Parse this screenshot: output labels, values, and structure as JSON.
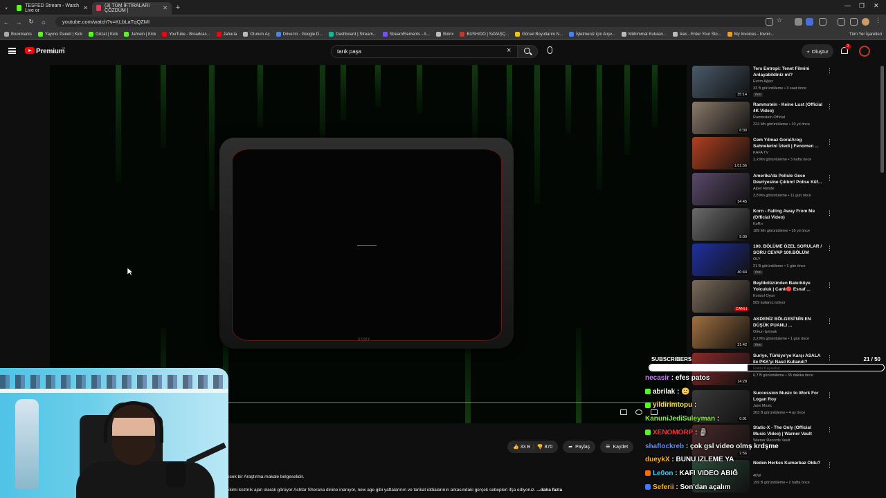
{
  "browser": {
    "tabs": [
      {
        "label": "TESFED Stream - Watch Live or",
        "color": "#53fc18",
        "active": false
      },
      {
        "label": "(3) TÜM İFTİRALARI ÇÖZDÜM |",
        "color": "#ff2d55",
        "active": true
      }
    ],
    "url": "youtube.com/watch?v=KLbLaTqQZMI",
    "bookmarks": [
      {
        "label": "Bookmarks",
        "color": "#aaaaaa"
      },
      {
        "label": "Yayıncı Paneli | Kick",
        "color": "#53fc18"
      },
      {
        "label": "Gözat | Kick",
        "color": "#53fc18"
      },
      {
        "label": "Jahrein | Kick",
        "color": "#53fc18"
      },
      {
        "label": "YouTube - Broadcas...",
        "color": "#ff0000"
      },
      {
        "label": "Jaharia",
        "color": "#ff0000"
      },
      {
        "label": "Oturum Aç",
        "color": "#bbbbbb"
      },
      {
        "label": "Drive'ım - Google D...",
        "color": "#4285f4"
      },
      {
        "label": "Dashboard | Stream...",
        "color": "#00bfa5"
      },
      {
        "label": "StreamElements - A...",
        "color": "#7b4dff"
      },
      {
        "label": "Botrix",
        "color": "#bbbbbb"
      },
      {
        "label": "BUSHIDO | SAVAŞÇ...",
        "color": "#c0392b"
      },
      {
        "label": "Görsel Boyutlarını N...",
        "color": "#f1c40f"
      },
      {
        "label": "İşletmeniz için Alışv...",
        "color": "#4285f4"
      },
      {
        "label": "Mühimmat Kutuları...",
        "color": "#bbbbbb"
      },
      {
        "label": "ikas - Enter Your Sto...",
        "color": "#bbbbbb"
      },
      {
        "label": "My Invoices - Invoic...",
        "color": "#f39c12"
      }
    ],
    "all_bookmarks": "Tüm Yer İşaretleri"
  },
  "youtube": {
    "brand": "Premium",
    "brand_region": "TR",
    "search_value": "tarık paşa",
    "create_label": "Oluştur",
    "notification_count": "3"
  },
  "video": {
    "tv_brand": "SONY",
    "actions": {
      "likes": "33 B",
      "dislikes": "870",
      "share": "Paylaş",
      "save": "Kaydet"
    },
    "description_line1": "ecek bir Araştırma makale belgeselidir.",
    "description_line2": "ut Ekimi kozmik ajan olarak görüyor Ashtar Sherana dinine inanıyor, new age gibi yaftalarının ve tarikat iddialarının arkasındaki gerçek sebepleri ifşa ediyoruz.",
    "description_more": "...daha fazla"
  },
  "recommendations": [
    {
      "title": "Ters Entropi: Tenet Filmini Anlayabildiniz mi?",
      "channel": "Evrim Ağacı",
      "meta": "33 B görüntüleme • 3 saat önce",
      "badge": "Yeni",
      "duration": "35:14",
      "thumb": "#4a5a6a"
    },
    {
      "title": "Rammstein - Keine Lust (Official 4K Video)",
      "channel": "Rammstein Official",
      "meta": "224 Mn görüntüleme • 10 yıl önce",
      "badge": "",
      "duration": "6:00",
      "thumb": "#8a7a6a"
    },
    {
      "title": "Cem Yılmaz Gora/Arog Sahnelerini İzledi | Fenomen ...",
      "channel": "KAFA TV",
      "meta": "2,2 Mn görüntüleme • 3 hafta önce",
      "badge": "",
      "duration": "1:01:56",
      "thumb": "#b04020"
    },
    {
      "title": "Amerika'da Polisle Gece Devriyesine Çıktım! Polise Küf...",
      "channel": "Alper Rende",
      "meta": "3,8 Mn görüntüleme • 11 gün önce",
      "badge": "",
      "duration": "34:45",
      "thumb": "#5a4a6a"
    },
    {
      "title": "Korn - Falling Away From Me (Official Video)",
      "channel": "KoRn",
      "meta": "189 Mn görüntüleme • 16 yıl önce",
      "badge": "",
      "duration": "5:00",
      "thumb": "#6a6a6a"
    },
    {
      "title": "100. BÖLÜME ÖZEL SORULAR / SORU CEVAP 100.BÖLÜM",
      "channel": "OLY",
      "meta": "21 B görüntüleme • 1 gün önce",
      "badge": "Yeni",
      "duration": "40:44",
      "thumb": "#2030a0"
    },
    {
      "title": "Beylikdüzünden Bakırköye Yolculuk | Canlı🔴 Esnaf ...",
      "channel": "Konsol Oyun",
      "meta": "509 kullanıcı izliyor",
      "badge": "",
      "duration": "CANLI",
      "thumb": "#7a6a5a"
    },
    {
      "title": "AKDENİZ BÖLGESİ'NİN EN DÜŞÜK PUANLI ...",
      "channel": "Orkun Işıtmak",
      "meta": "2,2 Mn görüntüleme • 1 gün önce",
      "badge": "Yeni",
      "duration": "31:42",
      "thumb": "#a07040"
    },
    {
      "title": "Suriye, Türkiye'ye Karşı ASALA ile PKK'yı Nasıl Kullandı?",
      "channel": "Rabia Kayaokur",
      "meta": "6,7 B görüntüleme • 35 dakika önce",
      "badge": "",
      "duration": "14:28",
      "thumb": "#8a2a2a"
    },
    {
      "title": "Succession Music to Work For Logan Roy",
      "channel": "Jaxx Music",
      "meta": "263 B görüntüleme • 4 ay önce",
      "badge": "",
      "duration": "0:01",
      "thumb": "#3a3a3a"
    },
    {
      "title": "Static-X - The Only (Official Music Video) | Warner Vault",
      "channel": "Warner Records Vault",
      "meta": "",
      "badge": "",
      "duration": "2:56",
      "thumb": "#4a2a2a"
    },
    {
      "title": "Neden Herkes Kumarbaz Oldu?",
      "channel": "40W",
      "meta": "199 B görüntüleme • 2 hafta önce",
      "badge": "",
      "duration": "",
      "thumb": "#2a4a3a"
    }
  ],
  "overlay": {
    "subscribers_label": "SUBSCRIBERS",
    "subscribers_current": 21,
    "subscribers_goal": 50,
    "subscribers_text": "21 / 50",
    "chat": [
      {
        "user": "necasir",
        "message": "efes patos",
        "color": "#c77dff",
        "badge": ""
      },
      {
        "user": "abrilak",
        "message": "🙂",
        "color": "#ffffff",
        "badge": "#53fc18"
      },
      {
        "user": "yildirimtopu",
        "message": "",
        "color": "#ffe600",
        "badge": "#53fc18"
      },
      {
        "user": "KanuniJediSuleyman",
        "message": "",
        "color": "#7cfc00",
        "badge": ""
      },
      {
        "user": "XENOMORP",
        "message": "🗿",
        "color": "#ff3030",
        "badge": "#53fc18"
      },
      {
        "user": "shaflockreb",
        "message": "çok gsl video olmş krdşme",
        "color": "#5b8cff",
        "badge": ""
      },
      {
        "user": "dueykX",
        "message": "BUNU IZLEME YA",
        "color": "#ffb020",
        "badge": ""
      },
      {
        "user": "Le0on",
        "message": "KAFI VIDEO ABIĞ",
        "color": "#3ad0ff",
        "badge": "#ff6b00"
      },
      {
        "user": "Seferii",
        "message": "Son'dan açalım",
        "color": "#ffb020",
        "badge": "#3a7bff"
      }
    ]
  }
}
